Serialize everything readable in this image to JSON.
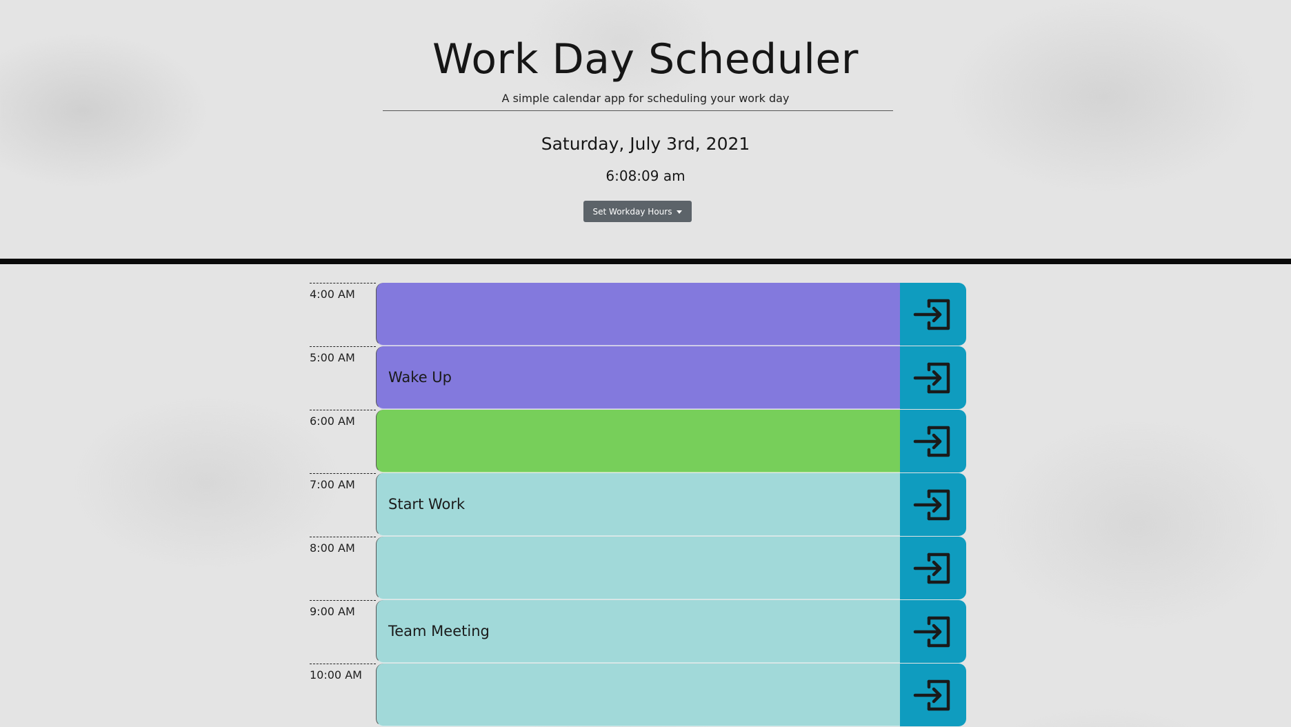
{
  "header": {
    "title": "Work Day Scheduler",
    "subtitle": "A simple calendar app for scheduling your work day",
    "date": "Saturday, July 3rd, 2021",
    "time": "6:08:09 am",
    "hours_button_label": "Set Workday Hours"
  },
  "colors": {
    "past": "#8379dd",
    "present": "#77cf5a",
    "future": "#a1d9d9",
    "save_button": "#0f9cbf",
    "divider": "#0a0a0a"
  },
  "schedule": {
    "rows": [
      {
        "hour": "4:00 AM",
        "text": "",
        "state": "past",
        "save_icon": "enter-icon"
      },
      {
        "hour": "5:00 AM",
        "text": "Wake Up",
        "state": "past",
        "save_icon": "enter-icon"
      },
      {
        "hour": "6:00 AM",
        "text": "",
        "state": "present",
        "save_icon": "enter-icon"
      },
      {
        "hour": "7:00 AM",
        "text": "Start Work",
        "state": "future",
        "save_icon": "enter-icon"
      },
      {
        "hour": "8:00 AM",
        "text": "",
        "state": "future",
        "save_icon": "enter-icon"
      },
      {
        "hour": "9:00 AM",
        "text": "Team Meeting",
        "state": "future",
        "save_icon": "enter-icon"
      },
      {
        "hour": "10:00 AM",
        "text": "",
        "state": "future",
        "save_icon": "enter-icon"
      }
    ]
  }
}
